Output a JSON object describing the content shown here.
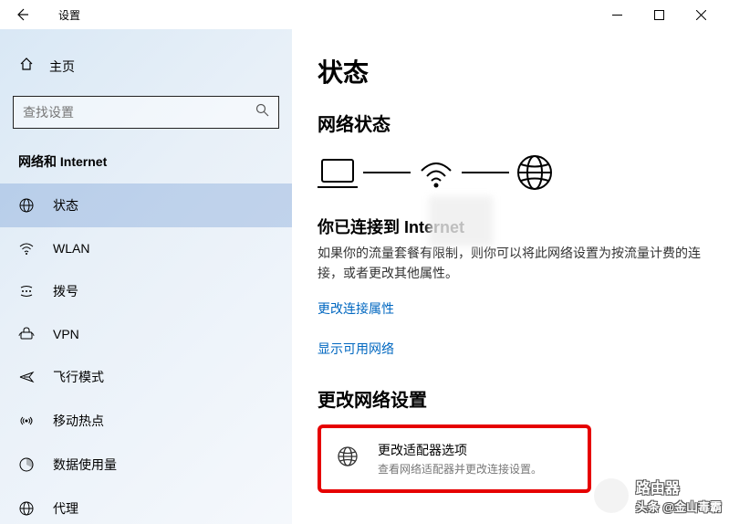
{
  "window": {
    "title": "设置"
  },
  "sidebar": {
    "home": "主页",
    "search_placeholder": "查找设置",
    "category": "网络和 Internet",
    "items": [
      {
        "label": "状态",
        "icon": "status"
      },
      {
        "label": "WLAN",
        "icon": "wifi"
      },
      {
        "label": "拨号",
        "icon": "dialup"
      },
      {
        "label": "VPN",
        "icon": "vpn"
      },
      {
        "label": "飞行模式",
        "icon": "airplane"
      },
      {
        "label": "移动热点",
        "icon": "hotspot"
      },
      {
        "label": "数据使用量",
        "icon": "data"
      },
      {
        "label": "代理",
        "icon": "proxy"
      }
    ]
  },
  "main": {
    "title": "状态",
    "network_status_heading": "网络状态",
    "connection_title": "你已连接到 Internet",
    "connection_desc": "如果你的流量套餐有限制，则你可以将此网络设置为按流量计费的连接，或者更改其他属性。",
    "link_change_props": "更改连接属性",
    "link_show_networks": "显示可用网络",
    "change_settings_heading": "更改网络设置",
    "adapter_title": "更改适配器选项",
    "adapter_desc": "查看网络适配器并更改连接设置。"
  },
  "watermark": {
    "brand": "路由器",
    "sub": "头条 @金山毒霸"
  }
}
